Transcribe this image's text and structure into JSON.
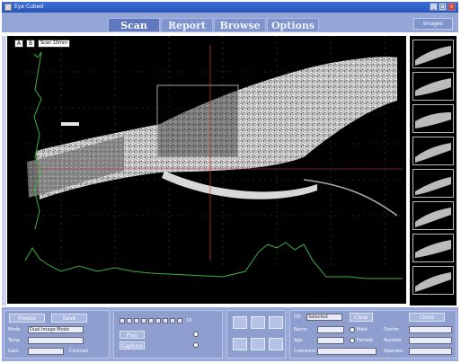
{
  "window": {
    "title": "Eye Cubed",
    "minimize": "_",
    "maximize": "□",
    "close": "x"
  },
  "tabs": [
    {
      "label": "Scan",
      "active": true
    },
    {
      "label": "Report",
      "active": false
    },
    {
      "label": "Browse",
      "active": false
    },
    {
      "label": "Options",
      "active": false
    }
  ],
  "images_button": "Images",
  "viewer": {
    "tool_a": "A",
    "tool_b": "B",
    "scan_label": "Scan 10mm"
  },
  "scan_controls": {
    "freeze_label": "Freeze",
    "save_label": "Save",
    "mode_label": "Mode",
    "mode_value": "Dual Image Mode",
    "temp_label": "Temp",
    "gain_label": "Gain",
    "contrast_label": "Contrast"
  },
  "cine_controls": {
    "play_label": "Play",
    "scale_label": "1X",
    "capture_label": "Capture"
  },
  "patient": {
    "eye_label": "OD",
    "eye_value": "Selected",
    "clear_label": "Clear",
    "close_label": "Close",
    "name_label": "Name",
    "age_label": "Age",
    "comment_label": "Comment",
    "doctor_label": "Doctor",
    "number_label": "Number",
    "operator_label": "Operator",
    "male_label": "Male",
    "female_label": "Female"
  },
  "colors": {
    "accent": "#93a6d6",
    "trace": "#3fae3f",
    "marker": "#d33b3b",
    "scan_bg": "#000000"
  }
}
